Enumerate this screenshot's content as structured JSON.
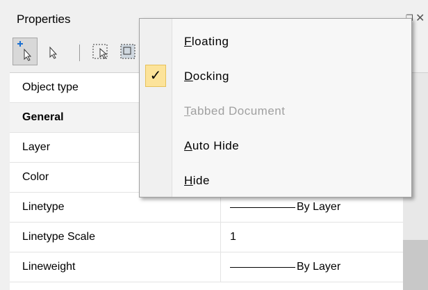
{
  "panel": {
    "title": "Properties"
  },
  "toolbar": {
    "buttons": [
      {
        "icon": "quick-select-icon"
      },
      {
        "icon": "select-objects-icon"
      },
      {
        "icon": "select-window-icon"
      },
      {
        "icon": "select-crossing-icon"
      }
    ]
  },
  "grid": {
    "rows": [
      {
        "name": "Object type",
        "value": "",
        "group": false
      },
      {
        "name": "General",
        "value": "",
        "group": true
      },
      {
        "name": "Layer",
        "value": "",
        "group": false
      },
      {
        "name": "Color",
        "value": "",
        "group": false
      },
      {
        "name": "Linetype",
        "value": "By Layer",
        "group": false,
        "linetype": true
      },
      {
        "name": "Linetype Scale",
        "value": "1",
        "group": false
      },
      {
        "name": "Lineweight",
        "value": "By Layer",
        "group": false,
        "linetype": true
      }
    ]
  },
  "menu": {
    "items": [
      {
        "label": "Floating",
        "accel": "F",
        "rest": "loating",
        "checked": false,
        "disabled": false
      },
      {
        "label": "Docking",
        "accel": "D",
        "rest": "ocking",
        "checked": true,
        "disabled": false
      },
      {
        "label": "Tabbed Document",
        "accel": "T",
        "rest": "abbed Document",
        "checked": false,
        "disabled": true
      },
      {
        "label": "Auto Hide",
        "accel": "A",
        "rest": "uto Hide",
        "checked": false,
        "disabled": false
      },
      {
        "label": "Hide",
        "accel": "H",
        "rest": "ide",
        "checked": false,
        "disabled": false
      }
    ],
    "check_glyph": "✓"
  },
  "colors": {
    "check_highlight": "#fce39a",
    "disabled_text": "#a0a0a0",
    "panel_bg": "#f0f0f0"
  }
}
